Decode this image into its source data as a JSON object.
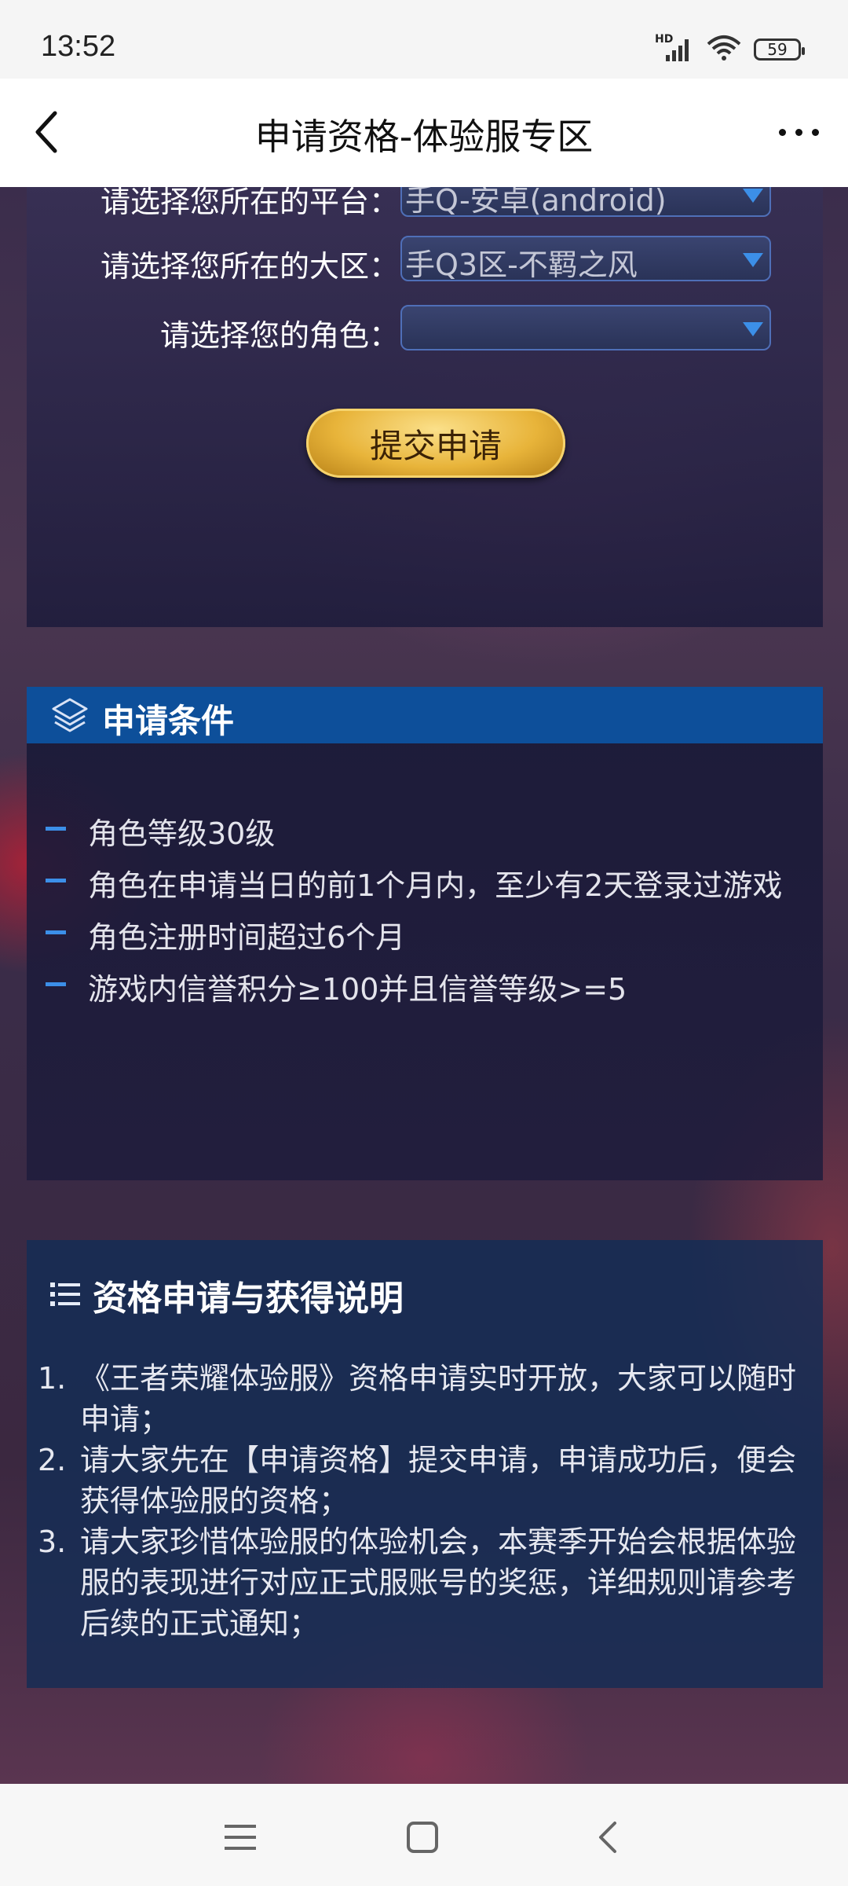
{
  "status_bar": {
    "time": "13:52",
    "network": "HD",
    "battery": "59"
  },
  "nav": {
    "title": "申请资格-体验服专区"
  },
  "form": {
    "rows": [
      {
        "label": "请选择您所在的平台：",
        "value": "手Q-安卓(android)"
      },
      {
        "label": "请选择您所在的大区：",
        "value": "手Q3区-不羁之风"
      },
      {
        "label": "请选择您的角色：",
        "value": ""
      }
    ],
    "submit_label": "提交申请"
  },
  "conditions": {
    "title": "申请条件",
    "items": [
      "角色等级30级",
      "角色在申请当日的前1个月内，至少有2天登录过游戏",
      "角色注册时间超过6个月",
      "游戏内信誉积分≥100并且信誉等级>=5"
    ]
  },
  "description": {
    "title": "资格申请与获得说明",
    "items": [
      {
        "num": "1.",
        "text": "《王者荣耀体验服》资格申请实时开放，大家可以随时申请；"
      },
      {
        "num": "2.",
        "text": "请大家先在【申请资格】提交申请，申请成功后，便会获得体验服的资格；"
      },
      {
        "num": "3.",
        "text": "请大家珍惜体验服的体验机会，本赛季开始会根据体验服的表现进行对应正式服账号的奖惩，详细规则请参考后续的正式通知；"
      }
    ]
  },
  "icons": {
    "back": "back-icon",
    "more": "more-icon",
    "layers": "layers-icon",
    "list": "list-icon",
    "sys_menu": "menu-icon",
    "sys_home": "home-icon",
    "sys_back": "back-icon"
  },
  "colors": {
    "header_blue": "#0d4f9a",
    "accent_blue": "#3c8fe8",
    "button_gold": "#e8b43a"
  }
}
